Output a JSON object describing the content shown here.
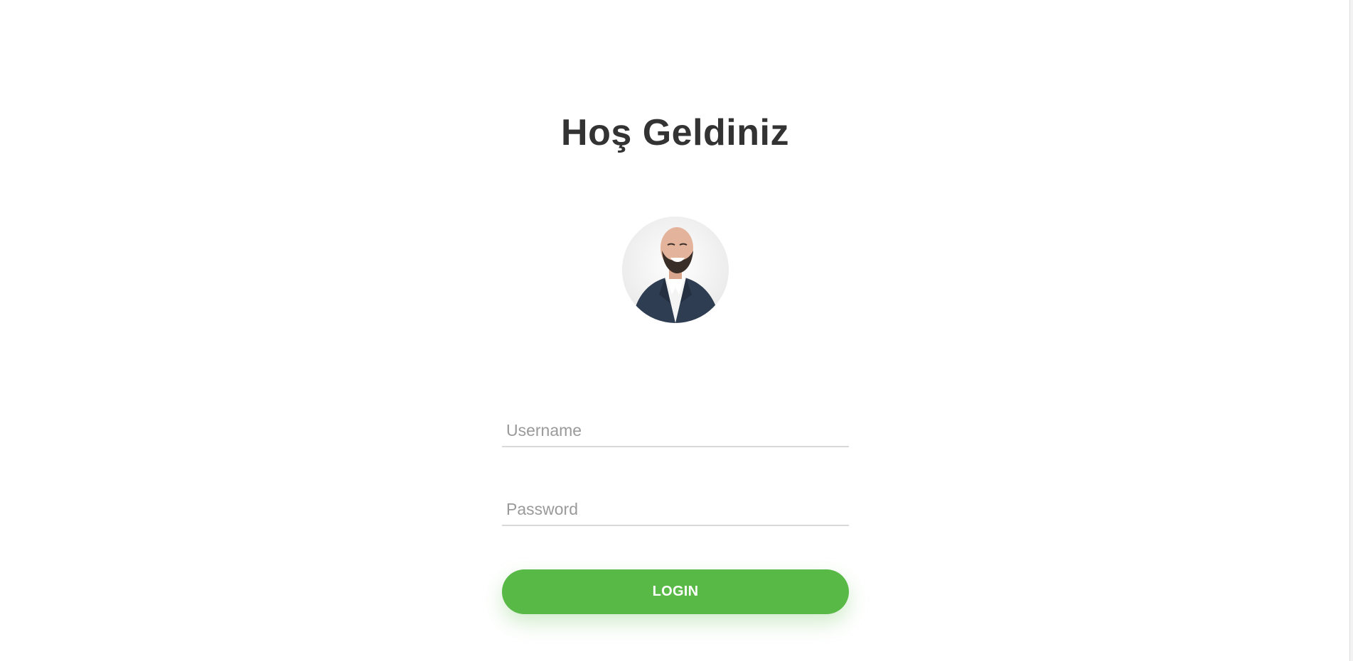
{
  "page": {
    "title": "Hoş Geldiniz"
  },
  "avatar": {
    "icon": "user-photo"
  },
  "form": {
    "username_placeholder": "Username",
    "username_value": "",
    "password_placeholder": "Password",
    "password_value": "",
    "login_label": "LOGIN"
  },
  "colors": {
    "accent": "#58b947",
    "title": "#333333",
    "placeholder": "#9a9a9a",
    "underline": "#d9d9d9"
  }
}
